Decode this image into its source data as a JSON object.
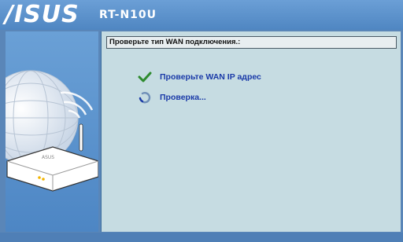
{
  "header": {
    "logo": "/ISUS",
    "model": "RT-N10U"
  },
  "content": {
    "title": "Проверьте тип WAN подключения.:",
    "steps": [
      {
        "label": "Проверьте WAN IP адрес",
        "icon": "checkmark-icon",
        "state": "done"
      },
      {
        "label": "Проверка...",
        "icon": "spinner-icon",
        "state": "in-progress"
      }
    ]
  },
  "colors": {
    "accent": "#1a3aa8",
    "check": "#2e8b2e",
    "panel": "#c6dce2",
    "header": "#5a8fcb"
  }
}
